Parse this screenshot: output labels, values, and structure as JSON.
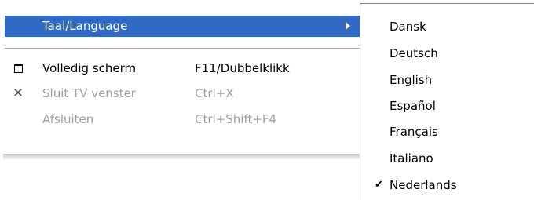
{
  "main_menu": {
    "items": [
      {
        "label": "Taal/Language",
        "shortcut": "",
        "has_submenu": true,
        "highlighted": true,
        "enabled": true,
        "icon": ""
      },
      {
        "label": "Volledig scherm",
        "shortcut": "F11/Dubbelklikk",
        "has_submenu": false,
        "highlighted": false,
        "enabled": true,
        "icon": "window-icon"
      },
      {
        "label": "Sluit TV venster",
        "shortcut": "Ctrl+X",
        "has_submenu": false,
        "highlighted": false,
        "enabled": false,
        "icon": "close-icon"
      },
      {
        "label": "Afsluiten",
        "shortcut": "Ctrl+Shift+F4",
        "has_submenu": false,
        "highlighted": false,
        "enabled": false,
        "icon": ""
      }
    ]
  },
  "language_submenu": {
    "items": [
      {
        "label": "Dansk",
        "checked": false
      },
      {
        "label": "Deutsch",
        "checked": false
      },
      {
        "label": "English",
        "checked": false
      },
      {
        "label": "Español",
        "checked": false
      },
      {
        "label": "Français",
        "checked": false
      },
      {
        "label": "Italiano",
        "checked": false
      },
      {
        "label": "Nederlands",
        "checked": true
      }
    ]
  },
  "icons": {
    "check": "✔",
    "close": "✕"
  },
  "colors": {
    "highlight": "#316ac5",
    "disabled_text": "#a0a0a0"
  }
}
